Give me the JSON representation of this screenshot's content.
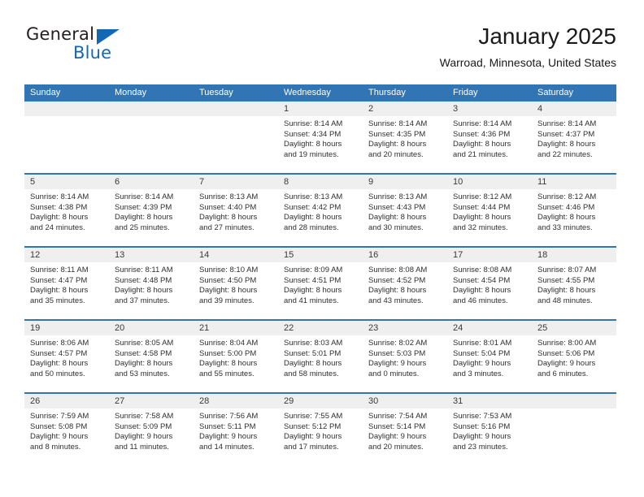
{
  "brand": {
    "name_primary": "General",
    "name_secondary": "Blue",
    "triangle_color": "#1268b3"
  },
  "header": {
    "title": "January 2025",
    "subtitle": "Warroad, Minnesota, United States"
  },
  "theme": {
    "header_blue": "#3275b4",
    "cell_shade": "#efefef",
    "text": "#2f2f2f"
  },
  "calendar": {
    "weekday_headers": [
      "Sunday",
      "Monday",
      "Tuesday",
      "Wednesday",
      "Thursday",
      "Friday",
      "Saturday"
    ],
    "weeks": [
      [
        {
          "day": "",
          "sunrise": "",
          "sunset": "",
          "daylight_line1": "",
          "daylight_line2": ""
        },
        {
          "day": "",
          "sunrise": "",
          "sunset": "",
          "daylight_line1": "",
          "daylight_line2": ""
        },
        {
          "day": "",
          "sunrise": "",
          "sunset": "",
          "daylight_line1": "",
          "daylight_line2": ""
        },
        {
          "day": "1",
          "sunrise": "Sunrise: 8:14 AM",
          "sunset": "Sunset: 4:34 PM",
          "daylight_line1": "Daylight: 8 hours",
          "daylight_line2": "and 19 minutes."
        },
        {
          "day": "2",
          "sunrise": "Sunrise: 8:14 AM",
          "sunset": "Sunset: 4:35 PM",
          "daylight_line1": "Daylight: 8 hours",
          "daylight_line2": "and 20 minutes."
        },
        {
          "day": "3",
          "sunrise": "Sunrise: 8:14 AM",
          "sunset": "Sunset: 4:36 PM",
          "daylight_line1": "Daylight: 8 hours",
          "daylight_line2": "and 21 minutes."
        },
        {
          "day": "4",
          "sunrise": "Sunrise: 8:14 AM",
          "sunset": "Sunset: 4:37 PM",
          "daylight_line1": "Daylight: 8 hours",
          "daylight_line2": "and 22 minutes."
        }
      ],
      [
        {
          "day": "5",
          "sunrise": "Sunrise: 8:14 AM",
          "sunset": "Sunset: 4:38 PM",
          "daylight_line1": "Daylight: 8 hours",
          "daylight_line2": "and 24 minutes."
        },
        {
          "day": "6",
          "sunrise": "Sunrise: 8:14 AM",
          "sunset": "Sunset: 4:39 PM",
          "daylight_line1": "Daylight: 8 hours",
          "daylight_line2": "and 25 minutes."
        },
        {
          "day": "7",
          "sunrise": "Sunrise: 8:13 AM",
          "sunset": "Sunset: 4:40 PM",
          "daylight_line1": "Daylight: 8 hours",
          "daylight_line2": "and 27 minutes."
        },
        {
          "day": "8",
          "sunrise": "Sunrise: 8:13 AM",
          "sunset": "Sunset: 4:42 PM",
          "daylight_line1": "Daylight: 8 hours",
          "daylight_line2": "and 28 minutes."
        },
        {
          "day": "9",
          "sunrise": "Sunrise: 8:13 AM",
          "sunset": "Sunset: 4:43 PM",
          "daylight_line1": "Daylight: 8 hours",
          "daylight_line2": "and 30 minutes."
        },
        {
          "day": "10",
          "sunrise": "Sunrise: 8:12 AM",
          "sunset": "Sunset: 4:44 PM",
          "daylight_line1": "Daylight: 8 hours",
          "daylight_line2": "and 32 minutes."
        },
        {
          "day": "11",
          "sunrise": "Sunrise: 8:12 AM",
          "sunset": "Sunset: 4:46 PM",
          "daylight_line1": "Daylight: 8 hours",
          "daylight_line2": "and 33 minutes."
        }
      ],
      [
        {
          "day": "12",
          "sunrise": "Sunrise: 8:11 AM",
          "sunset": "Sunset: 4:47 PM",
          "daylight_line1": "Daylight: 8 hours",
          "daylight_line2": "and 35 minutes."
        },
        {
          "day": "13",
          "sunrise": "Sunrise: 8:11 AM",
          "sunset": "Sunset: 4:48 PM",
          "daylight_line1": "Daylight: 8 hours",
          "daylight_line2": "and 37 minutes."
        },
        {
          "day": "14",
          "sunrise": "Sunrise: 8:10 AM",
          "sunset": "Sunset: 4:50 PM",
          "daylight_line1": "Daylight: 8 hours",
          "daylight_line2": "and 39 minutes."
        },
        {
          "day": "15",
          "sunrise": "Sunrise: 8:09 AM",
          "sunset": "Sunset: 4:51 PM",
          "daylight_line1": "Daylight: 8 hours",
          "daylight_line2": "and 41 minutes."
        },
        {
          "day": "16",
          "sunrise": "Sunrise: 8:08 AM",
          "sunset": "Sunset: 4:52 PM",
          "daylight_line1": "Daylight: 8 hours",
          "daylight_line2": "and 43 minutes."
        },
        {
          "day": "17",
          "sunrise": "Sunrise: 8:08 AM",
          "sunset": "Sunset: 4:54 PM",
          "daylight_line1": "Daylight: 8 hours",
          "daylight_line2": "and 46 minutes."
        },
        {
          "day": "18",
          "sunrise": "Sunrise: 8:07 AM",
          "sunset": "Sunset: 4:55 PM",
          "daylight_line1": "Daylight: 8 hours",
          "daylight_line2": "and 48 minutes."
        }
      ],
      [
        {
          "day": "19",
          "sunrise": "Sunrise: 8:06 AM",
          "sunset": "Sunset: 4:57 PM",
          "daylight_line1": "Daylight: 8 hours",
          "daylight_line2": "and 50 minutes."
        },
        {
          "day": "20",
          "sunrise": "Sunrise: 8:05 AM",
          "sunset": "Sunset: 4:58 PM",
          "daylight_line1": "Daylight: 8 hours",
          "daylight_line2": "and 53 minutes."
        },
        {
          "day": "21",
          "sunrise": "Sunrise: 8:04 AM",
          "sunset": "Sunset: 5:00 PM",
          "daylight_line1": "Daylight: 8 hours",
          "daylight_line2": "and 55 minutes."
        },
        {
          "day": "22",
          "sunrise": "Sunrise: 8:03 AM",
          "sunset": "Sunset: 5:01 PM",
          "daylight_line1": "Daylight: 8 hours",
          "daylight_line2": "and 58 minutes."
        },
        {
          "day": "23",
          "sunrise": "Sunrise: 8:02 AM",
          "sunset": "Sunset: 5:03 PM",
          "daylight_line1": "Daylight: 9 hours",
          "daylight_line2": "and 0 minutes."
        },
        {
          "day": "24",
          "sunrise": "Sunrise: 8:01 AM",
          "sunset": "Sunset: 5:04 PM",
          "daylight_line1": "Daylight: 9 hours",
          "daylight_line2": "and 3 minutes."
        },
        {
          "day": "25",
          "sunrise": "Sunrise: 8:00 AM",
          "sunset": "Sunset: 5:06 PM",
          "daylight_line1": "Daylight: 9 hours",
          "daylight_line2": "and 6 minutes."
        }
      ],
      [
        {
          "day": "26",
          "sunrise": "Sunrise: 7:59 AM",
          "sunset": "Sunset: 5:08 PM",
          "daylight_line1": "Daylight: 9 hours",
          "daylight_line2": "and 8 minutes."
        },
        {
          "day": "27",
          "sunrise": "Sunrise: 7:58 AM",
          "sunset": "Sunset: 5:09 PM",
          "daylight_line1": "Daylight: 9 hours",
          "daylight_line2": "and 11 minutes."
        },
        {
          "day": "28",
          "sunrise": "Sunrise: 7:56 AM",
          "sunset": "Sunset: 5:11 PM",
          "daylight_line1": "Daylight: 9 hours",
          "daylight_line2": "and 14 minutes."
        },
        {
          "day": "29",
          "sunrise": "Sunrise: 7:55 AM",
          "sunset": "Sunset: 5:12 PM",
          "daylight_line1": "Daylight: 9 hours",
          "daylight_line2": "and 17 minutes."
        },
        {
          "day": "30",
          "sunrise": "Sunrise: 7:54 AM",
          "sunset": "Sunset: 5:14 PM",
          "daylight_line1": "Daylight: 9 hours",
          "daylight_line2": "and 20 minutes."
        },
        {
          "day": "31",
          "sunrise": "Sunrise: 7:53 AM",
          "sunset": "Sunset: 5:16 PM",
          "daylight_line1": "Daylight: 9 hours",
          "daylight_line2": "and 23 minutes."
        },
        {
          "day": "",
          "sunrise": "",
          "sunset": "",
          "daylight_line1": "",
          "daylight_line2": ""
        }
      ]
    ]
  }
}
